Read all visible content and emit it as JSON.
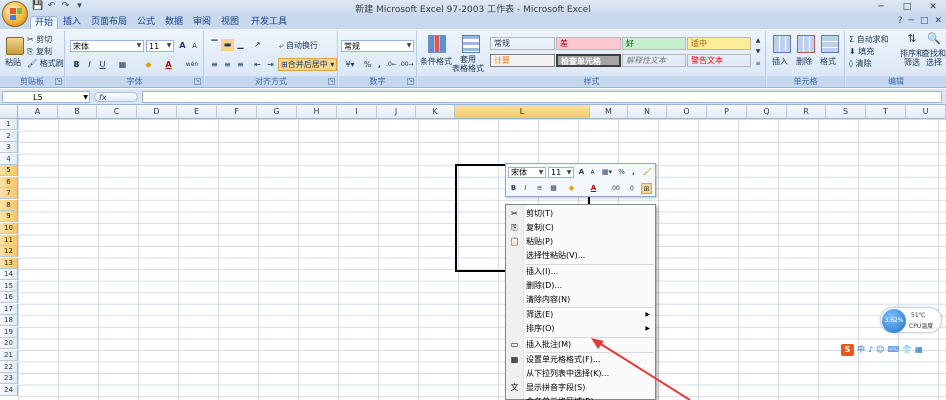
{
  "window": {
    "title": "新建 Microsoft Excel 97-2003 工作表 - Microsoft Excel",
    "controls": [
      "─",
      "□",
      "✕"
    ]
  },
  "qat": [
    "💾",
    "↶",
    "↷",
    "▾"
  ],
  "tabs": [
    "开始",
    "插入",
    "页面布局",
    "公式",
    "数据",
    "审阅",
    "视图",
    "开发工具"
  ],
  "tabs_right": [
    "?",
    "─",
    "□",
    "✕"
  ],
  "ribbon": {
    "clipboard": {
      "paste": "粘贴",
      "cut": "剪切",
      "copy": "复制",
      "format_painter": "格式刷",
      "label": "剪贴板"
    },
    "font": {
      "name": "宋体",
      "size": "11",
      "grow": "A",
      "shrink": "A",
      "bold": "B",
      "italic": "I",
      "underline": "U",
      "phonetic": "wén",
      "label": "字体"
    },
    "alignment": {
      "wrap": "自动换行",
      "merge": "合并后居中",
      "label": "对齐方式"
    },
    "number": {
      "format": "常规",
      "percent": "%",
      "comma": ",",
      "label": "数字"
    },
    "styles": {
      "conditional": "条件格式",
      "table": "套用\n表格格式",
      "cells": [
        {
          "text": "常规",
          "bg": "#ffffff",
          "fg": "#000000"
        },
        {
          "text": "差",
          "bg": "#ffc7ce",
          "fg": "#9c0006"
        },
        {
          "text": "好",
          "bg": "#c6efce",
          "fg": "#006100"
        },
        {
          "text": "适中",
          "bg": "#ffeb9c",
          "fg": "#9c5700"
        },
        {
          "text": "计算",
          "bg": "#f2f2f2",
          "fg": "#fa7d00"
        },
        {
          "text": "检查单元格",
          "bg": "#a5a5a5",
          "fg": "#ffffff"
        },
        {
          "text": "解释性文本",
          "bg": "#ffffff",
          "fg": "#7f7f7f"
        },
        {
          "text": "警告文本",
          "bg": "#ffffff",
          "fg": "#ff0000"
        }
      ],
      "label": "样式"
    },
    "cells_group": {
      "insert": "插入",
      "delete": "删除",
      "format": "格式",
      "label": "单元格"
    },
    "editing": {
      "autosum": "自动求和",
      "fill": "填充",
      "clear": "清除",
      "sort": "排序和\n筛选",
      "find": "查找和\n选择",
      "label": "编辑"
    }
  },
  "formula_bar": {
    "name_box": "L5",
    "fx": "fx",
    "value": ""
  },
  "columns": [
    "A",
    "B",
    "C",
    "D",
    "E",
    "F",
    "G",
    "H",
    "I",
    "J",
    "K",
    "L",
    "M",
    "N",
    "O",
    "P",
    "Q",
    "R",
    "S",
    "T",
    "U"
  ],
  "selected_column": "L",
  "rows": [
    "1",
    "2",
    "3",
    "4",
    "5",
    "6",
    "7",
    "8",
    "9",
    "10",
    "11",
    "12",
    "13",
    "14",
    "15",
    "16",
    "17",
    "18",
    "19",
    "20",
    "21",
    "22",
    "23",
    "24"
  ],
  "selected_rows": [
    "5",
    "6",
    "7",
    "8",
    "9",
    "10",
    "11",
    "12",
    "13"
  ],
  "mini_toolbar": {
    "font": "宋体",
    "size": "11",
    "grow": "A",
    "shrink": "A",
    "format": "",
    "percent": "%",
    "comma": ",",
    "bold": "B",
    "italic": "I",
    "align": "≡",
    "fill": "◆",
    "color": "A",
    "inc_dec": ".00",
    "dec_dec": ".0"
  },
  "context_menu": {
    "items": [
      {
        "label": "剪切(T)",
        "icon": "✂",
        "submenu": false,
        "sep_before": false
      },
      {
        "label": "复制(C)",
        "icon": "⎘",
        "submenu": false,
        "sep_before": false
      },
      {
        "label": "粘贴(P)",
        "icon": "📋",
        "submenu": false,
        "sep_before": false
      },
      {
        "label": "选择性粘贴(V)...",
        "icon": "",
        "submenu": false,
        "sep_before": false
      },
      {
        "label": "插入(I)...",
        "icon": "",
        "submenu": false,
        "sep_before": true
      },
      {
        "label": "删除(D)...",
        "icon": "",
        "submenu": false,
        "sep_before": false
      },
      {
        "label": "清除内容(N)",
        "icon": "",
        "submenu": false,
        "sep_before": false
      },
      {
        "label": "筛选(E)",
        "icon": "",
        "submenu": true,
        "sep_before": true
      },
      {
        "label": "排序(O)",
        "icon": "",
        "submenu": true,
        "sep_before": false
      },
      {
        "label": "插入批注(M)",
        "icon": "▭",
        "submenu": false,
        "sep_before": true
      },
      {
        "label": "设置单元格格式(F)...",
        "icon": "▦",
        "submenu": false,
        "sep_before": true
      },
      {
        "label": "从下拉列表中选择(K)...",
        "icon": "",
        "submenu": false,
        "sep_before": false
      },
      {
        "label": "显示拼音字段(S)",
        "icon": "文",
        "submenu": false,
        "sep_before": false
      },
      {
        "label": "命名单元格区域(R)...",
        "icon": "",
        "submenu": false,
        "sep_before": false
      }
    ]
  },
  "cpu_widget": {
    "percent": "3.62%",
    "temp": "51℃",
    "label": "CPU温度"
  },
  "ime": [
    "S",
    "中",
    "♪",
    "☺",
    "⌨",
    "👕",
    "▦"
  ],
  "colors": {
    "arrow": "#e23b3b",
    "selection": "#000000",
    "ribbon_bg": "#dbe7f5"
  }
}
